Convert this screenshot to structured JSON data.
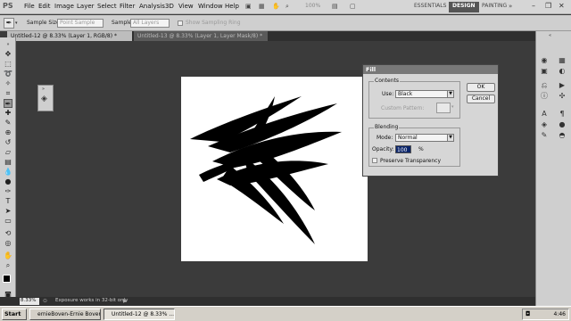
{
  "app": {
    "logo": "PS",
    "menu": [
      "File",
      "Edit",
      "Image",
      "Layer",
      "Select",
      "Filter",
      "Analysis",
      "3D",
      "View",
      "Window",
      "Help"
    ],
    "zoom_readout": "100%",
    "workspaces": [
      "ESSENTIALS",
      "DESIGN",
      "PAINTING"
    ],
    "active_workspace": "DESIGN"
  },
  "options": {
    "sample_size_label": "Sample Size:",
    "sample_size_value": "Point Sample",
    "sample_label": "Sample:",
    "sample_value": "All Layers",
    "sampling_ring_label": "Show Sampling Ring"
  },
  "tabs": [
    {
      "label": "Untitled-12 @ 8.33% (Layer 1, RGB/8) *",
      "active": true
    },
    {
      "label": "Untitled-13 @ 8.33% (Layer 1, Layer Mask/8) *",
      "active": false
    }
  ],
  "status": {
    "zoom": "8.33%",
    "message": "Exposure works in 32-bit only"
  },
  "dialog": {
    "title": "Fill",
    "contents_label": "Contents",
    "use_label": "Use:",
    "use_value": "Black",
    "custom_pattern_label": "Custom Pattern:",
    "blending_label": "Blending",
    "mode_label": "Mode:",
    "mode_value": "Normal",
    "opacity_label": "Opacity:",
    "opacity_value": "100",
    "opacity_unit": "%",
    "preserve_label": "Preserve Transparency",
    "ok_label": "OK",
    "cancel_label": "Cancel"
  },
  "taskbar": {
    "start_label": "Start",
    "tasks": [
      "ernieBoven-Ernie Boven...",
      "Untitled-12 @ 8.33% ..."
    ],
    "clock": "4:46"
  },
  "colors": {
    "accent_title": "#787878",
    "selection": "#0a246a",
    "pasteboard": "#3b3b3b"
  }
}
